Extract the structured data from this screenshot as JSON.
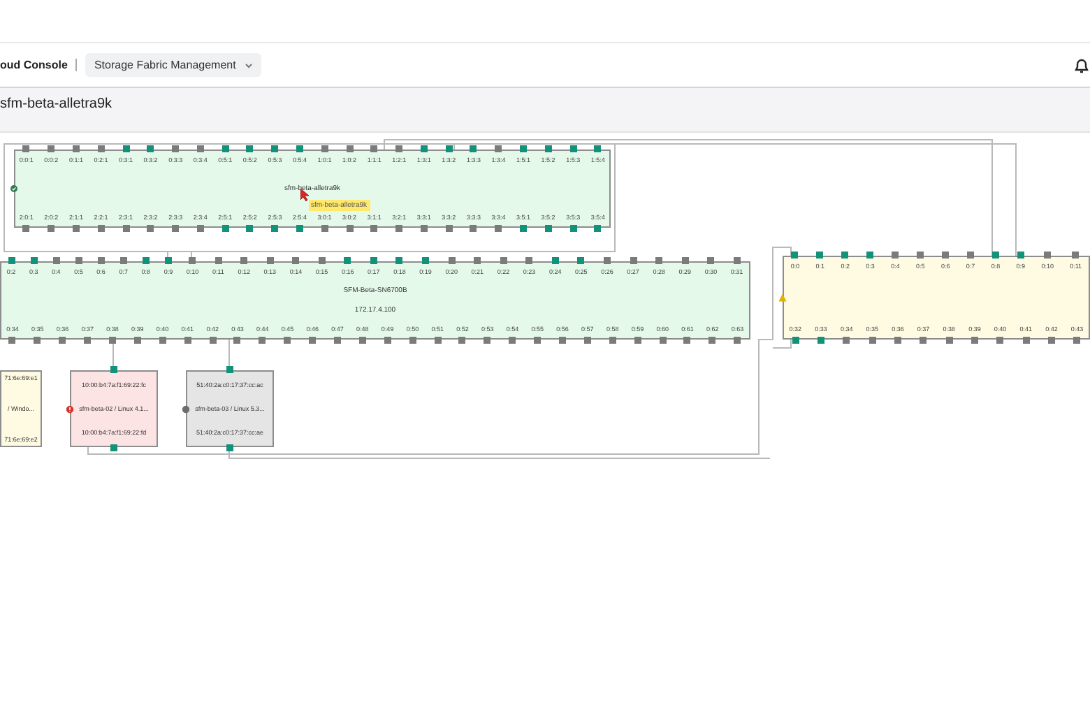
{
  "header": {
    "app_title": "oud Console",
    "menu": "Storage Fabric Management"
  },
  "page_title": "sfm-beta-alletra9k",
  "nodes": [
    {
      "kind": "storage",
      "color": "#e4f9ea",
      "healthy": true,
      "name": "sfm-beta-alletra9k",
      "tooltip": "sfm-beta-alletra9k",
      "top_ports": [
        {
          "label": "0:0:1",
          "active": false
        },
        {
          "label": "0:0:2",
          "active": false
        },
        {
          "label": "0:1:1",
          "active": false
        },
        {
          "label": "0:2:1",
          "active": false
        },
        {
          "label": "0:3:1",
          "active": true
        },
        {
          "label": "0:3:2",
          "active": true
        },
        {
          "label": "0:3:3",
          "active": false
        },
        {
          "label": "0:3:4",
          "active": false
        },
        {
          "label": "0:5:1",
          "active": true
        },
        {
          "label": "0:5:2",
          "active": true
        },
        {
          "label": "0:5:3",
          "active": true
        },
        {
          "label": "0:5:4",
          "active": true
        },
        {
          "label": "1:0:1",
          "active": false
        },
        {
          "label": "1:0:2",
          "active": false
        },
        {
          "label": "1:1:1",
          "active": false
        },
        {
          "label": "1:2:1",
          "active": false
        },
        {
          "label": "1:3:1",
          "active": true
        },
        {
          "label": "1:3:2",
          "active": true
        },
        {
          "label": "1:3:3",
          "active": true
        },
        {
          "label": "1:3:4",
          "active": false
        },
        {
          "label": "1:5:1",
          "active": true
        },
        {
          "label": "1:5:2",
          "active": true
        },
        {
          "label": "1:5:3",
          "active": true
        },
        {
          "label": "1:5:4",
          "active": true
        }
      ],
      "bottom_ports": [
        {
          "label": "2:0:1",
          "active": false
        },
        {
          "label": "2:0:2",
          "active": false
        },
        {
          "label": "2:1:1",
          "active": false
        },
        {
          "label": "2:2:1",
          "active": false
        },
        {
          "label": "2:3:1",
          "active": false
        },
        {
          "label": "2:3:2",
          "active": false
        },
        {
          "label": "2:3:3",
          "active": false
        },
        {
          "label": "2:3:4",
          "active": false
        },
        {
          "label": "2:5:1",
          "active": true
        },
        {
          "label": "2:5:2",
          "active": true
        },
        {
          "label": "2:5:3",
          "active": true
        },
        {
          "label": "2:5:4",
          "active": true
        },
        {
          "label": "3:0:1",
          "active": false
        },
        {
          "label": "3:0:2",
          "active": false
        },
        {
          "label": "3:1:1",
          "active": false
        },
        {
          "label": "3:2:1",
          "active": false
        },
        {
          "label": "3:3:1",
          "active": false
        },
        {
          "label": "3:3:2",
          "active": false
        },
        {
          "label": "3:3:3",
          "active": false
        },
        {
          "label": "3:3:4",
          "active": false
        },
        {
          "label": "3:5:1",
          "active": true
        },
        {
          "label": "3:5:2",
          "active": true
        },
        {
          "label": "3:5:3",
          "active": true
        },
        {
          "label": "3:5:4",
          "active": true
        }
      ]
    },
    {
      "kind": "switch",
      "color": "#e4f9ea",
      "name": "SFM-Beta-SN6700B",
      "address": "172.17.4.100",
      "top_ports": [
        {
          "label": "0:2",
          "active": true
        },
        {
          "label": "0:3",
          "active": true
        },
        {
          "label": "0:4",
          "active": false
        },
        {
          "label": "0:5",
          "active": false
        },
        {
          "label": "0:6",
          "active": false
        },
        {
          "label": "0:7",
          "active": false
        },
        {
          "label": "0:8",
          "active": true
        },
        {
          "label": "0:9",
          "active": true
        },
        {
          "label": "0:10",
          "active": false
        },
        {
          "label": "0:11",
          "active": false
        },
        {
          "label": "0:12",
          "active": false
        },
        {
          "label": "0:13",
          "active": false
        },
        {
          "label": "0:14",
          "active": false
        },
        {
          "label": "0:15",
          "active": false
        },
        {
          "label": "0:16",
          "active": true
        },
        {
          "label": "0:17",
          "active": true
        },
        {
          "label": "0:18",
          "active": true
        },
        {
          "label": "0:19",
          "active": true
        },
        {
          "label": "0:20",
          "active": false
        },
        {
          "label": "0:21",
          "active": false
        },
        {
          "label": "0:22",
          "active": false
        },
        {
          "label": "0:23",
          "active": false
        },
        {
          "label": "0:24",
          "active": true
        },
        {
          "label": "0:25",
          "active": true
        },
        {
          "label": "0:26",
          "active": false
        },
        {
          "label": "0:27",
          "active": false
        },
        {
          "label": "0:28",
          "active": false
        },
        {
          "label": "0:29",
          "active": false
        },
        {
          "label": "0:30",
          "active": false
        },
        {
          "label": "0:31",
          "active": false
        }
      ],
      "bottom_ports": [
        {
          "label": "0:34",
          "active": false
        },
        {
          "label": "0:35",
          "active": false
        },
        {
          "label": "0:36",
          "active": false
        },
        {
          "label": "0:37",
          "active": false
        },
        {
          "label": "0:38",
          "active": false
        },
        {
          "label": "0:39",
          "active": false
        },
        {
          "label": "0:40",
          "active": false
        },
        {
          "label": "0:41",
          "active": false
        },
        {
          "label": "0:42",
          "active": false
        },
        {
          "label": "0:43",
          "active": false
        },
        {
          "label": "0:44",
          "active": false
        },
        {
          "label": "0:45",
          "active": false
        },
        {
          "label": "0:46",
          "active": false
        },
        {
          "label": "0:47",
          "active": false
        },
        {
          "label": "0:48",
          "active": false
        },
        {
          "label": "0:49",
          "active": false
        },
        {
          "label": "0:50",
          "active": false
        },
        {
          "label": "0:51",
          "active": false
        },
        {
          "label": "0:52",
          "active": false
        },
        {
          "label": "0:53",
          "active": false
        },
        {
          "label": "0:54",
          "active": false
        },
        {
          "label": "0:55",
          "active": false
        },
        {
          "label": "0:56",
          "active": false
        },
        {
          "label": "0:57",
          "active": false
        },
        {
          "label": "0:58",
          "active": false
        },
        {
          "label": "0:59",
          "active": false
        },
        {
          "label": "0:60",
          "active": false
        },
        {
          "label": "0:61",
          "active": false
        },
        {
          "label": "0:62",
          "active": false
        },
        {
          "label": "0:63",
          "active": false
        }
      ]
    },
    {
      "kind": "switch",
      "color": "#fffbe3",
      "warning": true,
      "top_ports": [
        {
          "label": "0:0",
          "active": true
        },
        {
          "label": "0:1",
          "active": true
        },
        {
          "label": "0:2",
          "active": true
        },
        {
          "label": "0:3",
          "active": true
        },
        {
          "label": "0:4",
          "active": false
        },
        {
          "label": "0:5",
          "active": false
        },
        {
          "label": "0:6",
          "active": false
        },
        {
          "label": "0:7",
          "active": false
        },
        {
          "label": "0:8",
          "active": true
        },
        {
          "label": "0:9",
          "active": true
        },
        {
          "label": "0:10",
          "active": false
        },
        {
          "label": "0:11",
          "active": false
        }
      ],
      "bottom_ports": [
        {
          "label": "0:32",
          "active": true
        },
        {
          "label": "0:33",
          "active": true
        },
        {
          "label": "0:34",
          "active": false
        },
        {
          "label": "0:35",
          "active": false
        },
        {
          "label": "0:36",
          "active": false
        },
        {
          "label": "0:37",
          "active": false
        },
        {
          "label": "0:38",
          "active": false
        },
        {
          "label": "0:39",
          "active": false
        },
        {
          "label": "0:40",
          "active": false
        },
        {
          "label": "0:41",
          "active": false
        },
        {
          "label": "0:42",
          "active": false
        },
        {
          "label": "0:43",
          "active": false
        }
      ]
    },
    {
      "kind": "host",
      "color": "#fffbe3",
      "lines": [
        "71:6e:69:e1",
        "/ Windo...",
        "71:6e:69:e2"
      ]
    },
    {
      "kind": "host",
      "color": "#fde4e4",
      "error": true,
      "lines": [
        "10:00:b4:7a:f1:69:22:fc",
        "sfm-beta-02 / Linux 4.1...",
        "10:00:b4:7a:f1:69:22:fd"
      ],
      "top_ports": [
        {
          "active": true
        }
      ],
      "bottom_ports": [
        {
          "active": true
        }
      ]
    },
    {
      "kind": "host",
      "color": "#e5e5e5",
      "unknown": true,
      "lines": [
        "51:40:2a:c0:17:37:cc:ac",
        "sfm-beta-03 / Linux 5.3...",
        "51:40:2a:c0:17:37:cc:ae"
      ],
      "top_ports": [
        {
          "active": true
        }
      ],
      "bottom_ports": [
        {
          "active": true
        }
      ]
    }
  ]
}
